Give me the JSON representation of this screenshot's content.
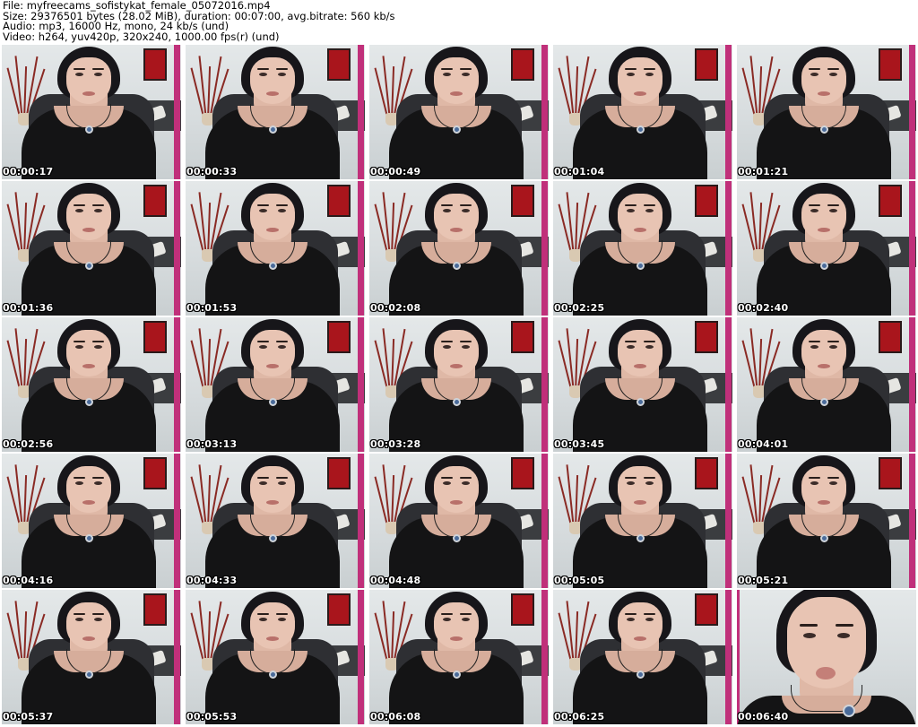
{
  "header": {
    "file_line": "File: myfreecams_sofistykat_female_05072016.mp4",
    "size_line": "Size: 29376501 bytes (28.02 MiB), duration: 00:07:00, avg.bitrate: 560 kb/s",
    "audio_line": "Audio: mp3, 16000 Hz, mono, 24 kb/s (und)",
    "video_line": "Video: h264, yuv420p, 320x240, 1000.00 fps(r) (und)"
  },
  "thumbnails": [
    {
      "time": "00:00:17",
      "closeup": false
    },
    {
      "time": "00:00:33",
      "closeup": false
    },
    {
      "time": "00:00:49",
      "closeup": false
    },
    {
      "time": "00:01:04",
      "closeup": false
    },
    {
      "time": "00:01:21",
      "closeup": false
    },
    {
      "time": "00:01:36",
      "closeup": false
    },
    {
      "time": "00:01:53",
      "closeup": false
    },
    {
      "time": "00:02:08",
      "closeup": false
    },
    {
      "time": "00:02:25",
      "closeup": false
    },
    {
      "time": "00:02:40",
      "closeup": false
    },
    {
      "time": "00:02:56",
      "closeup": false
    },
    {
      "time": "00:03:13",
      "closeup": false
    },
    {
      "time": "00:03:28",
      "closeup": false
    },
    {
      "time": "00:03:45",
      "closeup": false
    },
    {
      "time": "00:04:01",
      "closeup": false
    },
    {
      "time": "00:04:16",
      "closeup": false
    },
    {
      "time": "00:04:33",
      "closeup": false
    },
    {
      "time": "00:04:48",
      "closeup": false
    },
    {
      "time": "00:05:05",
      "closeup": false
    },
    {
      "time": "00:05:21",
      "closeup": false
    },
    {
      "time": "00:05:37",
      "closeup": false
    },
    {
      "time": "00:05:53",
      "closeup": false
    },
    {
      "time": "00:06:08",
      "closeup": false
    },
    {
      "time": "00:06:25",
      "closeup": false
    },
    {
      "time": "00:06:40",
      "closeup": true
    }
  ]
}
